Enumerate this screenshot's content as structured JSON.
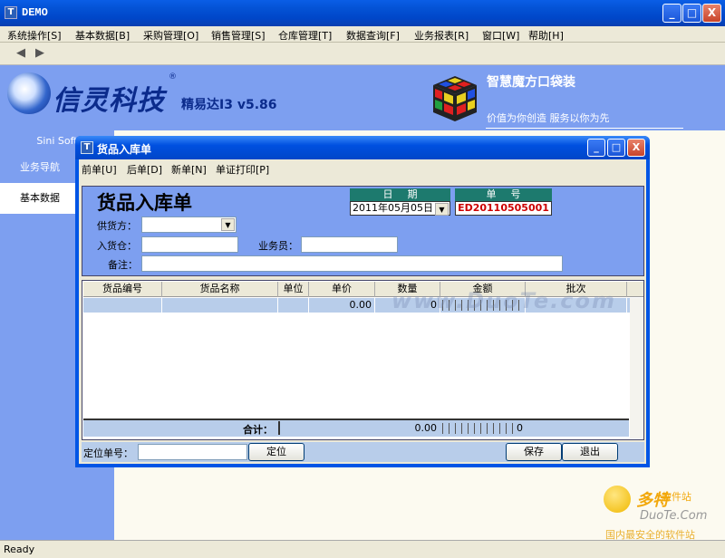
{
  "app": {
    "title": "DEMO",
    "icon_letter": "T",
    "window_buttons": {
      "minimize": "_",
      "maximize": "□",
      "close": "X"
    }
  },
  "menu": [
    "系统操作[S]",
    "基本数据[B]",
    "采购管理[O]",
    "销售管理[S]",
    "仓库管理[T]",
    "数据查询[F]",
    "业务报表[R]",
    "窗口[W]",
    "帮助[H]"
  ],
  "toolbar": {
    "back_icon": "back-arrow-icon",
    "forward_icon": "forward-arrow-icon"
  },
  "banner": {
    "logo_text": "信灵科技",
    "registered": "®",
    "product": "精易达I3  v5.86",
    "slogan_title": "智慧魔方口袋装",
    "slogan_sub": "价值为你创造  服务以你为先"
  },
  "sidebar": {
    "company": "Sini Soft",
    "items": [
      {
        "label": "业务导航",
        "active": false
      },
      {
        "label": "基本数据",
        "active": true
      }
    ]
  },
  "status": {
    "text": "Ready"
  },
  "dialog": {
    "title": "货品入库单",
    "icon_letter": "T",
    "menu": [
      "前单[U]",
      "后单[D]",
      "新单[N]",
      "单证打印[P]"
    ],
    "form": {
      "heading": "货品入库单",
      "supplier_label": "供货方：",
      "supplier_value": "",
      "warehouse_label": "入货仓：",
      "warehouse_value": "",
      "salesman_label": "业务员：",
      "salesman_value": "",
      "remark_label": "备注：",
      "remark_value": "",
      "date_label": "日期",
      "date_value": "2011年05月05日",
      "number_label": "单号",
      "number_value": "ED20110505001"
    },
    "grid": {
      "columns": [
        "货品编号",
        "货品名称",
        "单位",
        "单价",
        "数量",
        "金额",
        "批次"
      ],
      "rows": [
        {
          "code": "",
          "name": "",
          "unit": "",
          "price": "0.00",
          "qty": "0",
          "amount": "",
          "batch": ""
        }
      ],
      "footer": {
        "label": "合计：",
        "price_total": "0.00",
        "amount_total": "0"
      }
    },
    "bottom": {
      "locate_label": "定位单号：",
      "locate_value": "",
      "locate_button": "定位",
      "save_button": "保存",
      "exit_button": "退出"
    }
  },
  "watermarks": {
    "center": "www.DuoTe.com",
    "corner_cn": "多特",
    "corner_cn2": "软件站",
    "corner_en": "DuoTe.Com",
    "corner_tag": "国内最安全的软件站"
  },
  "colors": {
    "banner": "#7d9ff0",
    "titlebar": "#0055e5",
    "accent_red": "#cc0000",
    "header_teal": "#1d7a6e"
  }
}
